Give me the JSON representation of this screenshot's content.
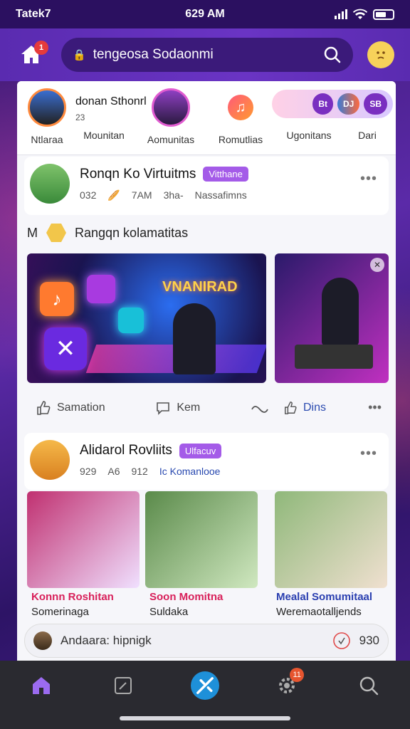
{
  "status_bar": {
    "carrier": "Tatek7",
    "time": "629 AM"
  },
  "header": {
    "home_badge": "1",
    "search_text": "tengeosa Sodaonmi"
  },
  "stories": {
    "title": "donan Sthonrl",
    "sub_count": "23",
    "items": [
      {
        "label": "Ntlaraa"
      },
      {
        "label": "Mounitan"
      },
      {
        "label": "Aomunitas"
      },
      {
        "label": "Romutlias"
      },
      {
        "label": "Ugonitans"
      },
      {
        "label": "Dari"
      }
    ],
    "pill_icons": [
      "Bt",
      "DJ",
      "SB"
    ]
  },
  "post1": {
    "name": "Ronqn Ko Virtuitms",
    "tag": "Vitthane",
    "meta": [
      "032",
      "7AM",
      "3ha-",
      "Nassafimns"
    ],
    "subline": "Rangqn kolamatitas",
    "subline_prefix": "M",
    "banner_text": "VNANIRAD",
    "actions": {
      "like": "Samation",
      "comment": "Kem",
      "share": "Dins"
    }
  },
  "post2": {
    "name": "Alidarol Rovliits",
    "tag": "Ulfacuv",
    "meta": [
      "929",
      "A6",
      "912",
      "Ic Komanlooe"
    ],
    "thumbs": [
      {
        "title": "Konnn Roshitan",
        "sub": "Somerinaga",
        "color": "#d8205a"
      },
      {
        "title": "Soon Momitna",
        "sub": "Suldaka",
        "color": "#d8205a"
      },
      {
        "title": "Mealal Somumitaal",
        "sub": "Weremaotalljends",
        "color": "#2a3fb0"
      }
    ]
  },
  "compose": {
    "placeholder": "Andaara: hipnigk",
    "count": "930"
  },
  "tabbar": {
    "settings_badge": "11"
  },
  "colors": {
    "brand": "#5a2bb0",
    "accent": "#a45be8",
    "tabbar": "#2a2a30"
  }
}
